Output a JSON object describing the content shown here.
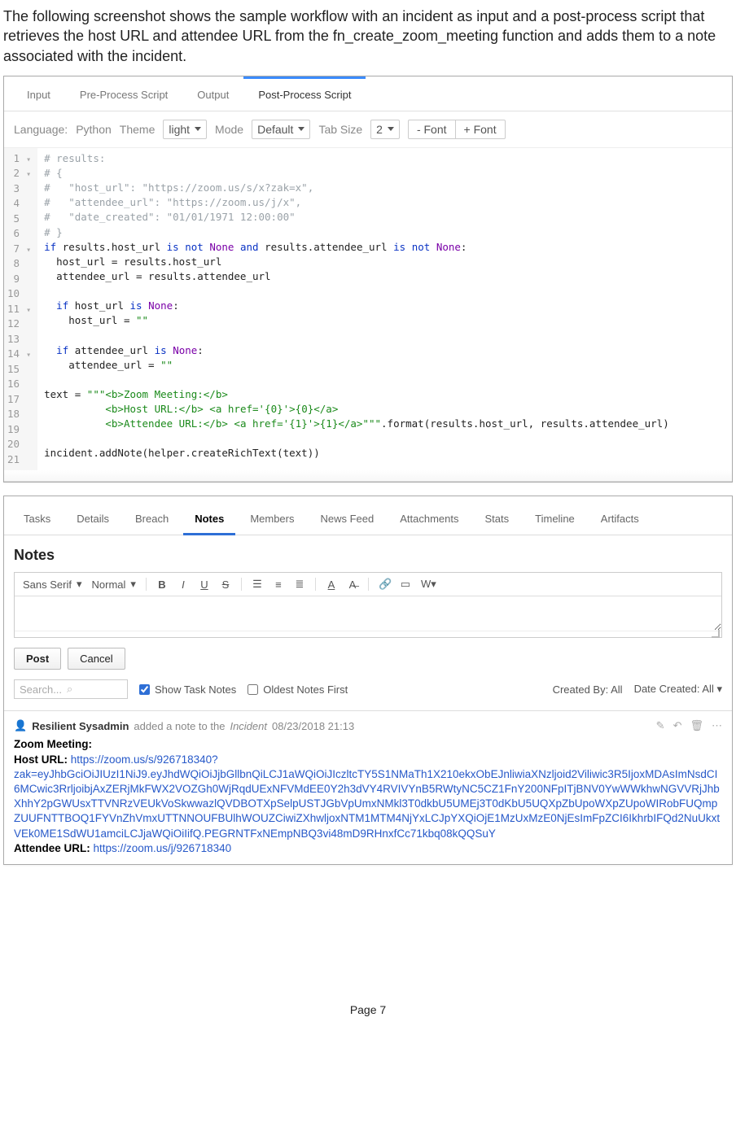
{
  "intro": "The following screenshot shows the sample workflow with an incident as input and a post-process script that retrieves the host URL and attendee URL from the fn_create_zoom_meeting function and adds them to a note associated with the incident.",
  "tabs1": {
    "items": [
      "Input",
      "Pre-Process Script",
      "Output",
      "Post-Process Script"
    ],
    "active": 3
  },
  "toolbar": {
    "languageLabel": "Language:",
    "languageValue": "Python",
    "themeLabel": "Theme",
    "themeValue": "light",
    "modeLabel": "Mode",
    "modeValue": "Default",
    "tabSizeLabel": "Tab Size",
    "tabSizeValue": "2",
    "fontMinus": "- Font",
    "fontPlus": "+ Font"
  },
  "code": {
    "lines": [
      {
        "n": "1",
        "fold": "▾",
        "segs": [
          {
            "t": "# results:",
            "c": "c-comment"
          }
        ]
      },
      {
        "n": "2",
        "fold": "▾",
        "segs": [
          {
            "t": "# {",
            "c": "c-comment"
          }
        ]
      },
      {
        "n": "3",
        "segs": [
          {
            "t": "#   \"host_url\": \"https://zoom.us/s/x?zak=x\",",
            "c": "c-comment"
          }
        ]
      },
      {
        "n": "4",
        "segs": [
          {
            "t": "#   \"attendee_url\": \"https://zoom.us/j/x\",",
            "c": "c-comment"
          }
        ]
      },
      {
        "n": "5",
        "segs": [
          {
            "t": "#   \"date_created\": \"01/01/1971 12:00:00\"",
            "c": "c-comment"
          }
        ]
      },
      {
        "n": "6",
        "segs": [
          {
            "t": "# }",
            "c": "c-comment"
          }
        ]
      },
      {
        "n": "7",
        "fold": "▾",
        "segs": [
          {
            "t": "if",
            "c": "c-kw"
          },
          {
            "t": " results.host_url "
          },
          {
            "t": "is not",
            "c": "c-kw"
          },
          {
            "t": " "
          },
          {
            "t": "None",
            "c": "c-none"
          },
          {
            "t": " "
          },
          {
            "t": "and",
            "c": "c-kw"
          },
          {
            "t": " results.attendee_url "
          },
          {
            "t": "is not",
            "c": "c-kw"
          },
          {
            "t": " "
          },
          {
            "t": "None",
            "c": "c-none"
          },
          {
            "t": ":"
          }
        ]
      },
      {
        "n": "8",
        "segs": [
          {
            "t": "  host_url = results.host_url"
          }
        ]
      },
      {
        "n": "9",
        "segs": [
          {
            "t": "  attendee_url = results.attendee_url"
          }
        ]
      },
      {
        "n": "10",
        "segs": [
          {
            "t": ""
          }
        ]
      },
      {
        "n": "11",
        "fold": "▾",
        "segs": [
          {
            "t": "  "
          },
          {
            "t": "if",
            "c": "c-kw"
          },
          {
            "t": " host_url "
          },
          {
            "t": "is",
            "c": "c-kw"
          },
          {
            "t": " "
          },
          {
            "t": "None",
            "c": "c-none"
          },
          {
            "t": ":"
          }
        ]
      },
      {
        "n": "12",
        "segs": [
          {
            "t": "    host_url = "
          },
          {
            "t": "\"\"",
            "c": "c-str"
          }
        ]
      },
      {
        "n": "13",
        "segs": [
          {
            "t": ""
          }
        ]
      },
      {
        "n": "14",
        "fold": "▾",
        "segs": [
          {
            "t": "  "
          },
          {
            "t": "if",
            "c": "c-kw"
          },
          {
            "t": " attendee_url "
          },
          {
            "t": "is",
            "c": "c-kw"
          },
          {
            "t": " "
          },
          {
            "t": "None",
            "c": "c-none"
          },
          {
            "t": ":"
          }
        ]
      },
      {
        "n": "15",
        "segs": [
          {
            "t": "    attendee_url = "
          },
          {
            "t": "\"\"",
            "c": "c-str"
          }
        ]
      },
      {
        "n": "16",
        "segs": [
          {
            "t": ""
          }
        ]
      },
      {
        "n": "17",
        "segs": [
          {
            "t": "text = "
          },
          {
            "t": "\"\"\"<b>Zoom Meeting:</b>",
            "c": "c-str"
          }
        ]
      },
      {
        "n": "18",
        "segs": [
          {
            "t": "          "
          },
          {
            "t": "<b>Host URL:</b> <a href='{0}'>{0}</a>",
            "c": "c-str"
          }
        ]
      },
      {
        "n": "19",
        "segs": [
          {
            "t": "          "
          },
          {
            "t": "<b>Attendee URL:</b> <a href='{1}'>{1}</a>\"\"\"",
            "c": "c-str"
          },
          {
            "t": ".format(results.host_url, results.attendee_url)"
          }
        ]
      },
      {
        "n": "20",
        "segs": [
          {
            "t": ""
          }
        ]
      },
      {
        "n": "21",
        "segs": [
          {
            "t": "incident.addNote(helper.createRichText(text))"
          }
        ]
      }
    ]
  },
  "tabs2": {
    "items": [
      "Tasks",
      "Details",
      "Breach",
      "Notes",
      "Members",
      "News Feed",
      "Attachments",
      "Stats",
      "Timeline",
      "Artifacts"
    ],
    "active": 3
  },
  "notes": {
    "title": "Notes",
    "rte": {
      "font": "Sans Serif",
      "size": "Normal"
    },
    "postBtn": "Post",
    "cancelBtn": "Cancel",
    "searchPlaceholder": "Search...",
    "showTaskNotes": "Show Task Notes",
    "oldestFirst": "Oldest Notes First",
    "createdBy": "Created By: All",
    "dateCreated": "Date Created: All"
  },
  "note": {
    "author": "Resilient Sysadmin",
    "action": "added a note to the",
    "target": "Incident",
    "timestamp": "08/23/2018 21:13",
    "title": "Zoom Meeting:",
    "hostLabel": "Host URL:",
    "hostUrl": "https://zoom.us/s/926718340?zak=eyJhbGciOiJIUzI1NiJ9.eyJhdWQiOiJjbGllbnQiLCJ1aWQiOiJIczltcTY5S1NMaTh1X210ekxObEJnliwiaXNzljoid2Viliwic3R5IjoxMDAsImNsdCI6MCwic3RrljoibjAxZERjMkFWX2VOZGh0WjRqdUExNFVMdEE0Y2h3dVY4RVIVYnB5RWtyNC5CZ1FnY200NFpITjBNV0YwWWkhwNGVVRjJhbXhhY2pGWUsxTTVNRzVEUkVoSkwwazlQVDBOTXpSelpUSTJGbVpUmxNMkl3T0dkbU5UMEj3T0dKbU5UQXpZbUpoWXpZUpoWIRobFUQmpZUUFNTTBOQ1FYVnZhVmxUTTNNOUFBUlhWOUZCiwiZXhwljoxNTM1MTM4NjYxLCJpYXQiOjE1MzUxMzE0NjEsImFpZCI6IkhrbIFQd2NuUkxtVEk0ME1SdWU1amciLCJjaWQiOiIifQ.PEGRNTFxNEmpNBQ3vi48mD9RHnxfCc71kbq08kQQSuY",
    "attendeeLabel": "Attendee URL:",
    "attendeeUrl": "https://zoom.us/j/926718340"
  },
  "footer": "Page 7"
}
